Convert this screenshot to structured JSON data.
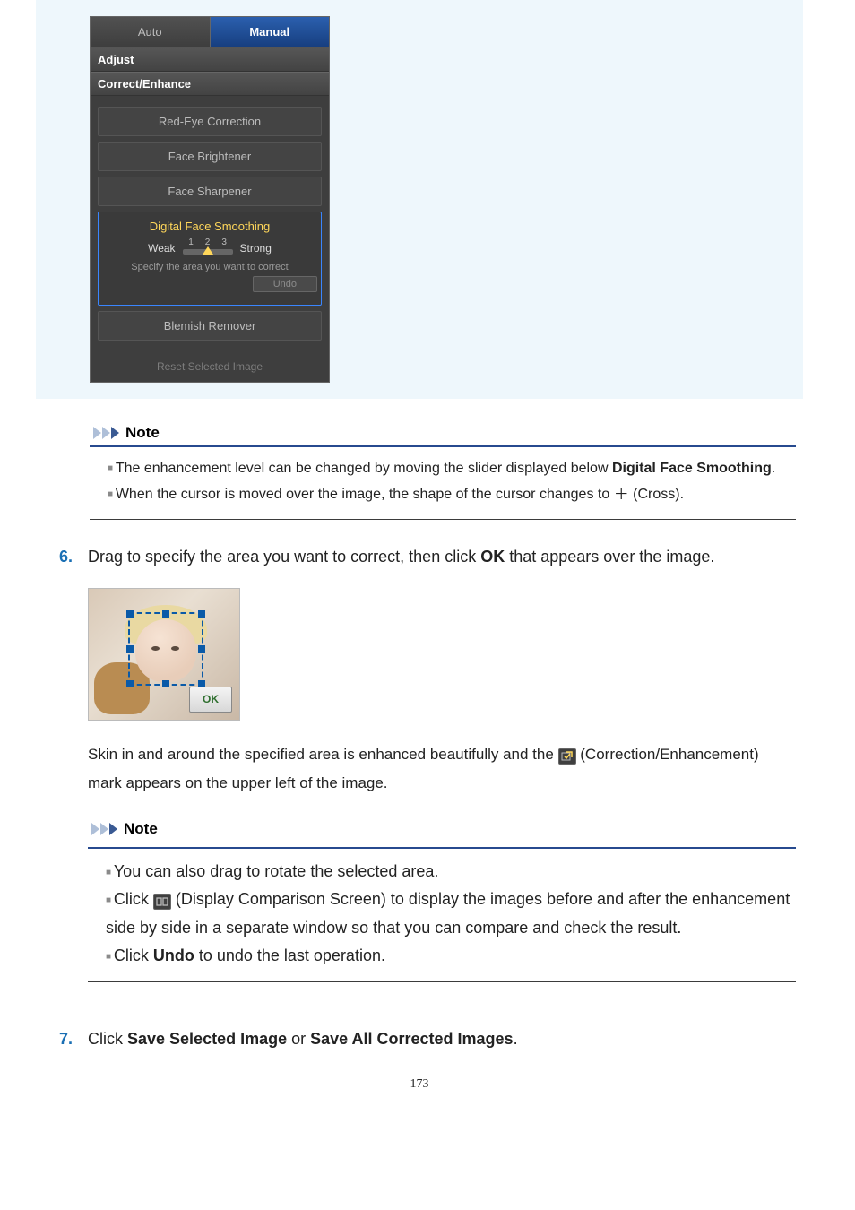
{
  "panel": {
    "tab_auto": "Auto",
    "tab_manual": "Manual",
    "adjust_hdr": "Adjust",
    "correct_hdr": "Correct/Enhance",
    "redeye": "Red-Eye Correction",
    "brightener": "Face Brightener",
    "sharpener": "Face Sharpener",
    "smoothing": "Digital Face Smoothing",
    "weak": "Weak",
    "strong": "Strong",
    "tick1": "1",
    "tick2": "2",
    "tick3": "3",
    "specify": "Specify the area you want to correct",
    "undo_btn": "Undo",
    "blemish": "Blemish Remover",
    "reset": "Reset Selected Image"
  },
  "note_label": "Note",
  "note1": {
    "li1a": "The enhancement level can be changed by moving the slider displayed below ",
    "li1b": "Digital Face Smoothing",
    "li1c": ".",
    "li2a": "When the cursor is moved over the image, the shape of the cursor changes to ",
    "li2b": " (Cross)."
  },
  "cross_glyph": "＋",
  "step6": {
    "num": "6.",
    "text_a": "Drag to specify the area you want to correct, then click ",
    "text_b": "OK",
    "text_c": " that appears over the image.",
    "ok_btn": "OK",
    "para_a": "Skin in and around the specified area is enhanced beautifully and the ",
    "para_b": " (Correction/Enhancement) mark appears on the upper left of the image."
  },
  "note2": {
    "li1": "You can also drag to rotate the selected area.",
    "li2a": "Click ",
    "li2b": " (Display Comparison Screen) to display the images before and after the enhancement side by side in a separate window so that you can compare and check the result.",
    "li3a": "Click ",
    "li3b": "Undo",
    "li3c": " to undo the last operation."
  },
  "step7": {
    "num": "7.",
    "a": "Click ",
    "b": "Save Selected Image",
    "c": " or ",
    "d": "Save All Corrected Images",
    "e": "."
  },
  "page_number": "173"
}
